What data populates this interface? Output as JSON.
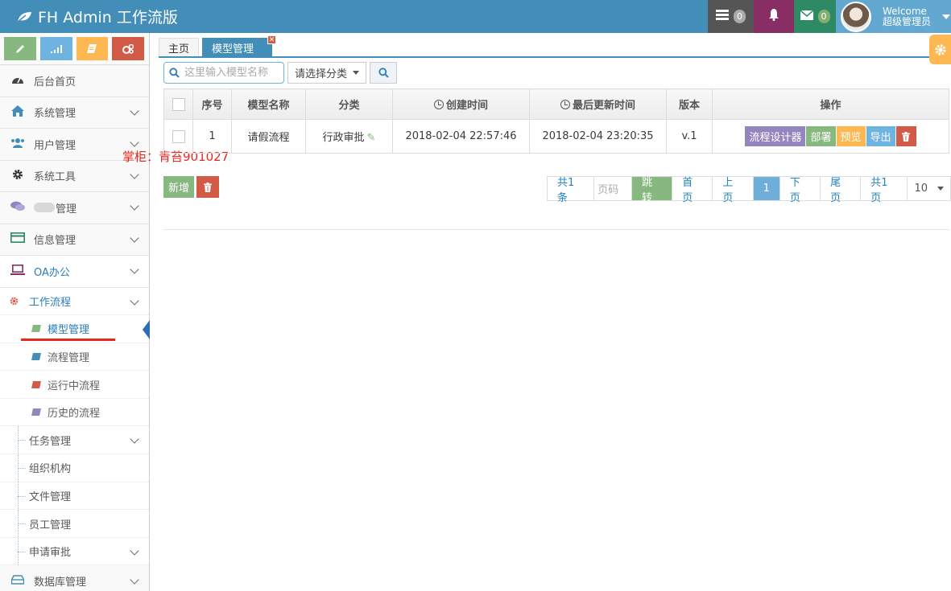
{
  "app": {
    "title": "FH Admin 工作流版",
    "tasks_count": "0",
    "mail_count": "0",
    "welcome_line1": "Welcome",
    "welcome_line2": "超级管理员"
  },
  "sidebar": {
    "menu_top": [
      {
        "label": "后台首页",
        "icon": "dashboard-icon",
        "has_chevron": false
      },
      {
        "label": "系统管理",
        "icon": "home-icon",
        "has_chevron": true
      },
      {
        "label": "用户管理",
        "icon": "users-icon",
        "has_chevron": true
      },
      {
        "label": "系统工具",
        "icon": "cog-icon",
        "has_chevron": true
      },
      {
        "label": "管理",
        "icon": "chat-icon",
        "has_chevron": true
      },
      {
        "label": "信息管理",
        "icon": "credit-card-icon",
        "has_chevron": true
      },
      {
        "label": "OA办公",
        "icon": "laptop-icon",
        "has_chevron": true
      }
    ],
    "workflow": {
      "label": "工作流程",
      "items": [
        {
          "label": "模型管理",
          "active": true,
          "color": "#87b87f"
        },
        {
          "label": "流程管理",
          "active": false,
          "color": "#438eb9"
        },
        {
          "label": "运行中流程",
          "active": false,
          "color": "#d15b47"
        },
        {
          "label": "历史的流程",
          "active": false,
          "color": "#9585bf"
        }
      ]
    },
    "oa_items": [
      {
        "label": "任务管理",
        "has_chevron": true
      },
      {
        "label": "组织机构",
        "has_chevron": false
      },
      {
        "label": "文件管理",
        "has_chevron": false
      },
      {
        "label": "员工管理",
        "has_chevron": false
      },
      {
        "label": "申请审批",
        "has_chevron": true
      }
    ],
    "menu_bottom": {
      "label": "数据库管理",
      "icon": "hdd-icon"
    }
  },
  "watermark": "掌柜：青苔901027",
  "tabs": [
    {
      "label": "主页",
      "active": false
    },
    {
      "label": "模型管理",
      "active": true
    }
  ],
  "search": {
    "placeholder": "这里输入模型名称",
    "category_select": "请选择分类"
  },
  "table": {
    "headers": [
      "序号",
      "模型名称",
      "分类",
      "创建时间",
      "最后更新时间",
      "版本",
      "操作"
    ],
    "rows": [
      {
        "index": "1",
        "name": "请假流程",
        "category": "行政审批",
        "created": "2018-02-04 22:57:46",
        "updated": "2018-02-04 23:20:35",
        "version": "v.1"
      }
    ],
    "row_actions": {
      "designer": "流程设计器",
      "deploy": "部署",
      "preview": "预览",
      "export": "导出"
    }
  },
  "actions": {
    "add": "新增"
  },
  "pager": {
    "total": "共1条",
    "page_input_placeholder": "页码",
    "jump": "跳转",
    "first": "首页",
    "prev": "上页",
    "current": "1",
    "next": "下页",
    "last": "尾页",
    "pages": "共1页",
    "page_size": "10"
  },
  "colors": {
    "navbar": "#438eb9",
    "green": "#87b87f",
    "red": "#d15b47",
    "orange": "#ffb752",
    "blue": "#6fb3e0",
    "purple": "#9585bf"
  }
}
